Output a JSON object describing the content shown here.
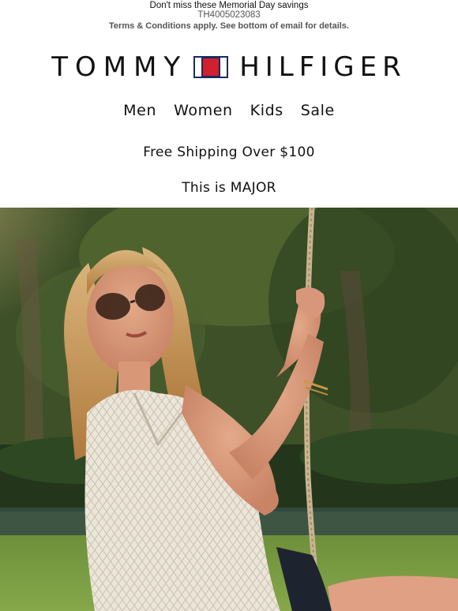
{
  "preheader": {
    "line1": "Don't miss these Memorial Day savings",
    "line2": "TH4005023083",
    "line3": "Terms & Conditions apply. See bottom of email for details."
  },
  "brand": {
    "left": "TOMMY",
    "right": "HILFIGER",
    "flag_colors": {
      "navy": "#1a2b5e",
      "red": "#d2202f",
      "white": "#ffffff"
    }
  },
  "nav": {
    "items": [
      {
        "label": "Men"
      },
      {
        "label": "Women"
      },
      {
        "label": "Kids"
      },
      {
        "label": "Sale"
      }
    ]
  },
  "promo": {
    "shipping": "Free Shipping Over $100",
    "headline": "This is MAJOR"
  },
  "hero": {
    "icon": "hero-photo-woman-on-rope-swing"
  }
}
